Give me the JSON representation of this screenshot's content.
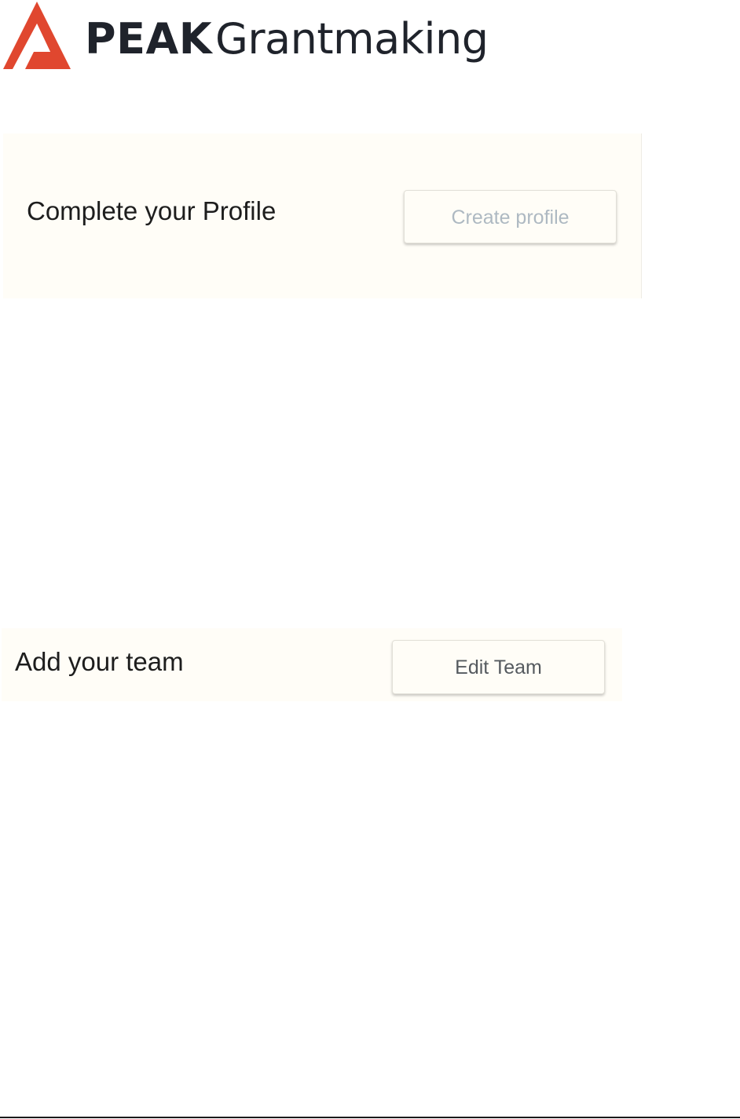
{
  "brand": {
    "name_bold": "PEAK",
    "name_light": "Grantmaking",
    "logo_icon": "peak-triangle-icon",
    "logo_color": "#e0472f",
    "text_color": "#1f232b"
  },
  "profile_card": {
    "title": "Complete your Profile",
    "button_label": "Create profile",
    "button_state": "disabled"
  },
  "team_card": {
    "title": "Add your team",
    "button_label": "Edit Team"
  },
  "colors": {
    "card_background": "#fffdf7",
    "disabled_text": "#aeb9c2",
    "button_text": "#555a5f"
  }
}
